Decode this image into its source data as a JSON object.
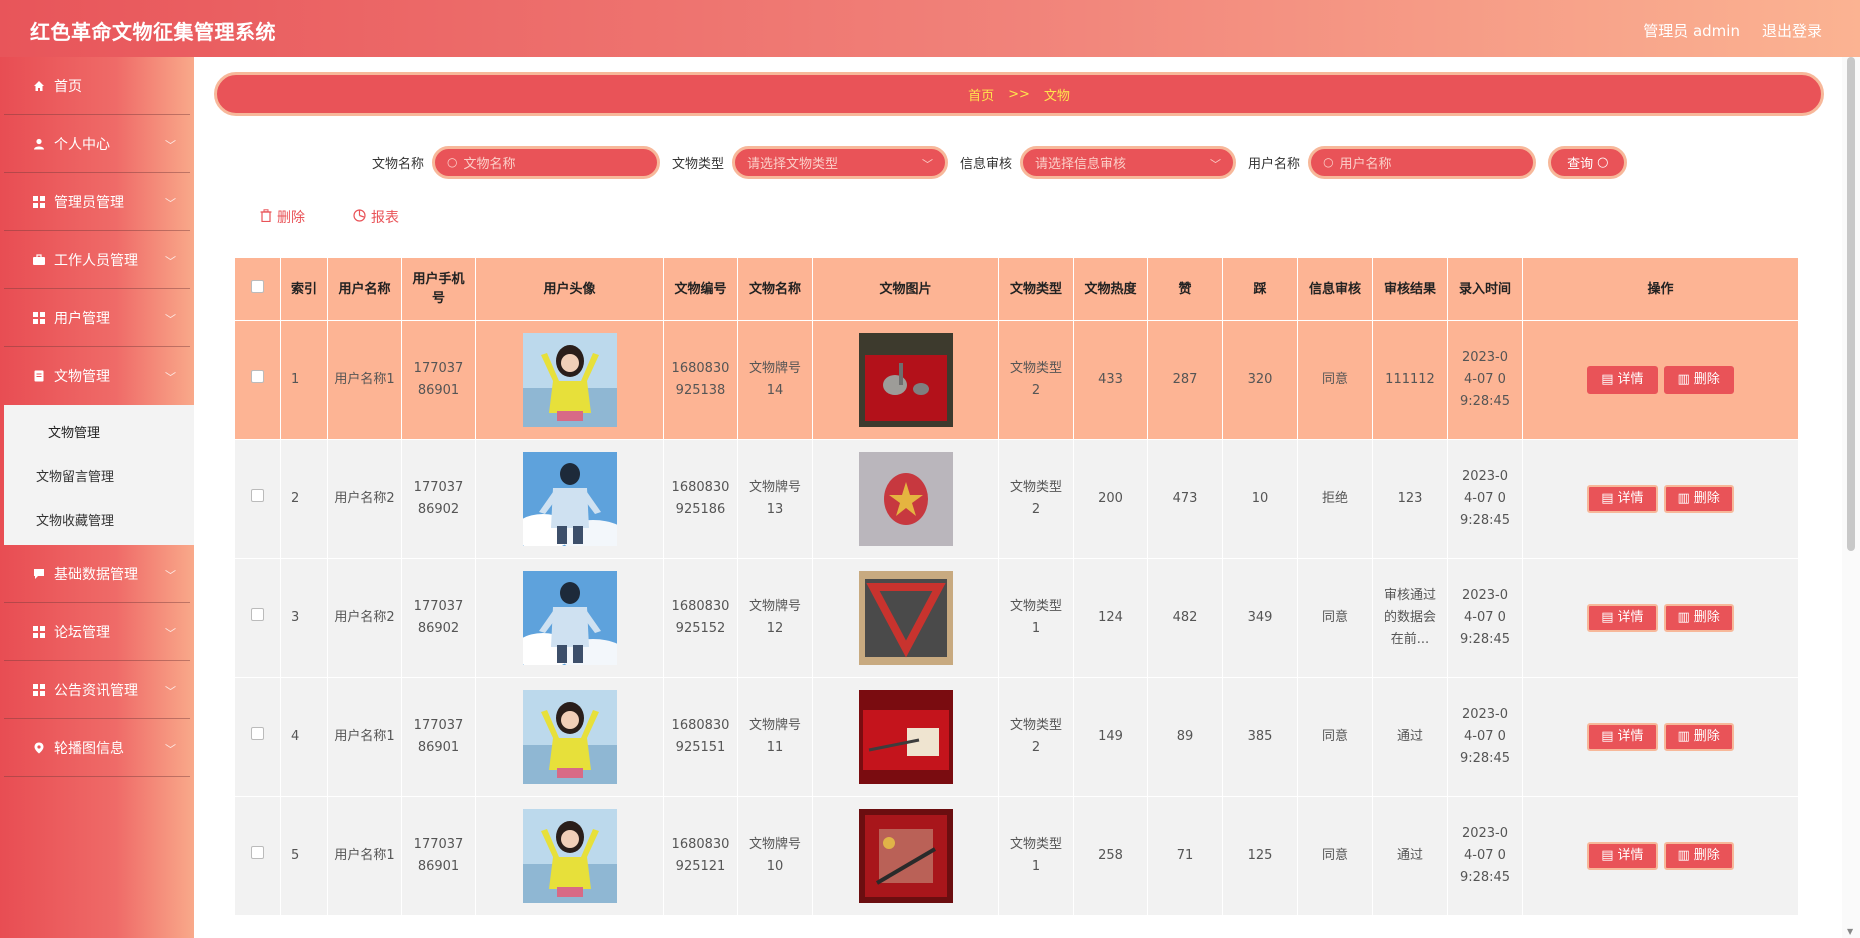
{
  "header": {
    "title": "红色革命文物征集管理系统",
    "admin_label": "管理员 admin",
    "logout_label": "退出登录"
  },
  "sidebar": {
    "items": [
      {
        "label": "首页",
        "icon": "home-icon"
      },
      {
        "label": "个人中心",
        "icon": "user-icon"
      },
      {
        "label": "管理员管理",
        "icon": "grid-icon"
      },
      {
        "label": "工作人员管理",
        "icon": "briefcase-icon"
      },
      {
        "label": "用户管理",
        "icon": "grid-icon"
      },
      {
        "label": "文物管理",
        "icon": "document-icon"
      },
      {
        "label": "基础数据管理",
        "icon": "chat-icon"
      },
      {
        "label": "论坛管理",
        "icon": "grid-icon"
      },
      {
        "label": "公告资讯管理",
        "icon": "grid-icon"
      },
      {
        "label": "轮播图信息",
        "icon": "location-icon"
      }
    ],
    "submenu": [
      "文物管理",
      "文物留言管理",
      "文物收藏管理"
    ]
  },
  "breadcrumb": {
    "home": "首页",
    "sep": ">>",
    "current": "文物"
  },
  "filters": {
    "name_label": "文物名称",
    "name_placeholder": "文物名称",
    "type_label": "文物类型",
    "type_placeholder": "请选择文物类型",
    "audit_label": "信息审核",
    "audit_placeholder": "请选择信息审核",
    "user_label": "用户名称",
    "user_placeholder": "用户名称",
    "query_label": "查询"
  },
  "actions": {
    "delete_label": "删除",
    "report_label": "报表"
  },
  "table": {
    "headers": [
      "索引",
      "用户名称",
      "用户手机号",
      "用户头像",
      "文物编号",
      "文物名称",
      "文物图片",
      "文物类型",
      "文物热度",
      "赞",
      "踩",
      "信息审核",
      "审核结果",
      "录入时间",
      "操作"
    ],
    "detail_label": "详情",
    "delete_label": "删除",
    "rows": [
      {
        "index": "1",
        "user": "用户名称1",
        "phone": "17703786901",
        "code": "1680830925138",
        "name": "文物牌号14",
        "type": "文物类型2",
        "heat": "433",
        "like": "287",
        "dislike": "320",
        "audit": "同意",
        "result": "111112",
        "time": "2023-04-07 09:28:45"
      },
      {
        "index": "2",
        "user": "用户名称2",
        "phone": "17703786902",
        "code": "1680830925186",
        "name": "文物牌号13",
        "type": "文物类型2",
        "heat": "200",
        "like": "473",
        "dislike": "10",
        "audit": "拒绝",
        "result": "123",
        "time": "2023-04-07 09:28:45"
      },
      {
        "index": "3",
        "user": "用户名称2",
        "phone": "17703786902",
        "code": "1680830925152",
        "name": "文物牌号12",
        "type": "文物类型1",
        "heat": "124",
        "like": "482",
        "dislike": "349",
        "audit": "同意",
        "result": "审核通过的数据会在前...",
        "time": "2023-04-07 09:28:45"
      },
      {
        "index": "4",
        "user": "用户名称1",
        "phone": "17703786901",
        "code": "1680830925151",
        "name": "文物牌号11",
        "type": "文物类型2",
        "heat": "149",
        "like": "89",
        "dislike": "385",
        "audit": "同意",
        "result": "通过",
        "time": "2023-04-07 09:28:45"
      },
      {
        "index": "5",
        "user": "用户名称1",
        "phone": "17703786901",
        "code": "1680830925121",
        "name": "文物牌号10",
        "type": "文物类型1",
        "heat": "258",
        "like": "71",
        "dislike": "125",
        "audit": "同意",
        "result": "通过",
        "time": "2023-04-07 09:28:45"
      }
    ]
  },
  "colors": {
    "primary": "#e95358",
    "accent": "#fdb494",
    "crumb_text": "#ffe44d"
  }
}
